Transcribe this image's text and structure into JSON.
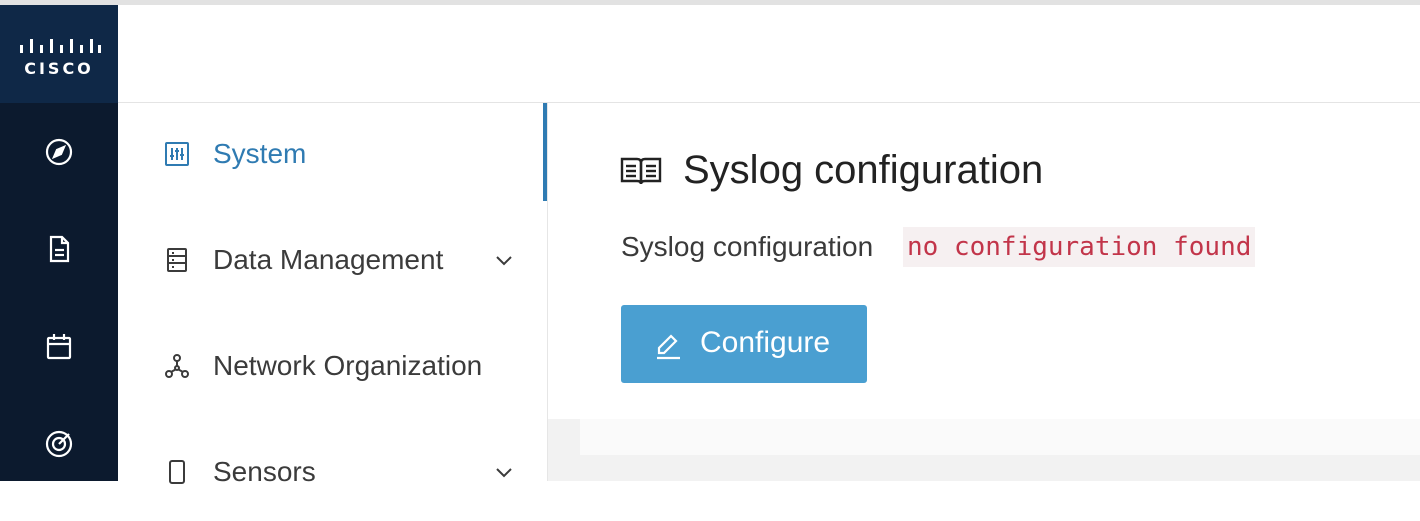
{
  "brand": {
    "logo_text": "CISCO"
  },
  "rail": {
    "icons": [
      "compass-icon",
      "document-icon",
      "calendar-icon",
      "target-icon"
    ]
  },
  "subnav": {
    "items": [
      {
        "label": "System",
        "icon": "sliders-icon",
        "active": true
      },
      {
        "label": "Data Management",
        "icon": "list-icon",
        "expandable": true
      },
      {
        "label": "Network Organization",
        "icon": "network-icon"
      },
      {
        "label": "Sensors",
        "icon": "device-icon",
        "expandable": true
      }
    ]
  },
  "main": {
    "title": "Syslog configuration",
    "title_icon": "book-icon",
    "field_label": "Syslog configuration",
    "field_value": "no configuration found",
    "configure_button": {
      "label": "Configure",
      "icon": "pencil-icon"
    }
  },
  "colors": {
    "rail": "#0c1a2e",
    "logo_bg": "#0f2847",
    "accent": "#2f7bb2",
    "button": "#4a9fd1",
    "code_text": "#c2354a",
    "code_bg": "#f6f0f1"
  }
}
